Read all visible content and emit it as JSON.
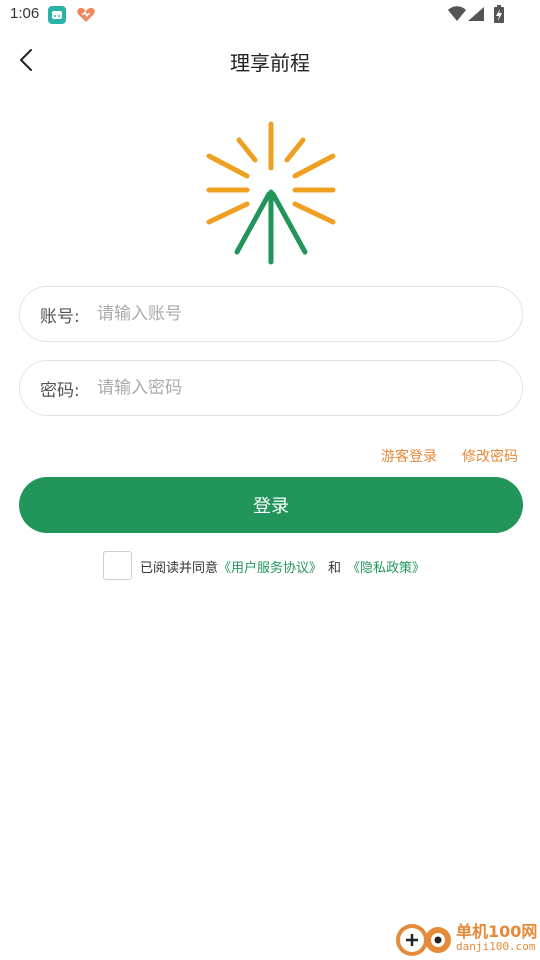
{
  "status_bar": {
    "time": "1:06"
  },
  "nav": {
    "title": "理享前程"
  },
  "form": {
    "account": {
      "label": "账号:",
      "placeholder": "请输入账号"
    },
    "password": {
      "label": "密码:",
      "placeholder": "请输入密码"
    }
  },
  "links": {
    "guest_login": "游客登录",
    "modify_password": "修改密码"
  },
  "login_button": {
    "label": "登录"
  },
  "agreement": {
    "checked": false,
    "prefix": "已阅读并同意",
    "user_agreement": "《用户服务协议》",
    "and": "和",
    "privacy_policy": "《隐私政策》"
  },
  "watermark": {
    "name": "单机100网",
    "url": "danji100.com"
  },
  "colors": {
    "primary_green": "#22965a",
    "accent_orange": "#e58a3a",
    "logo_yellow": "#f0a020"
  },
  "icons": {
    "back": "chevron-left-icon",
    "wifi": "wifi-icon",
    "signal": "cell-signal-icon",
    "battery": "battery-charging-icon"
  }
}
